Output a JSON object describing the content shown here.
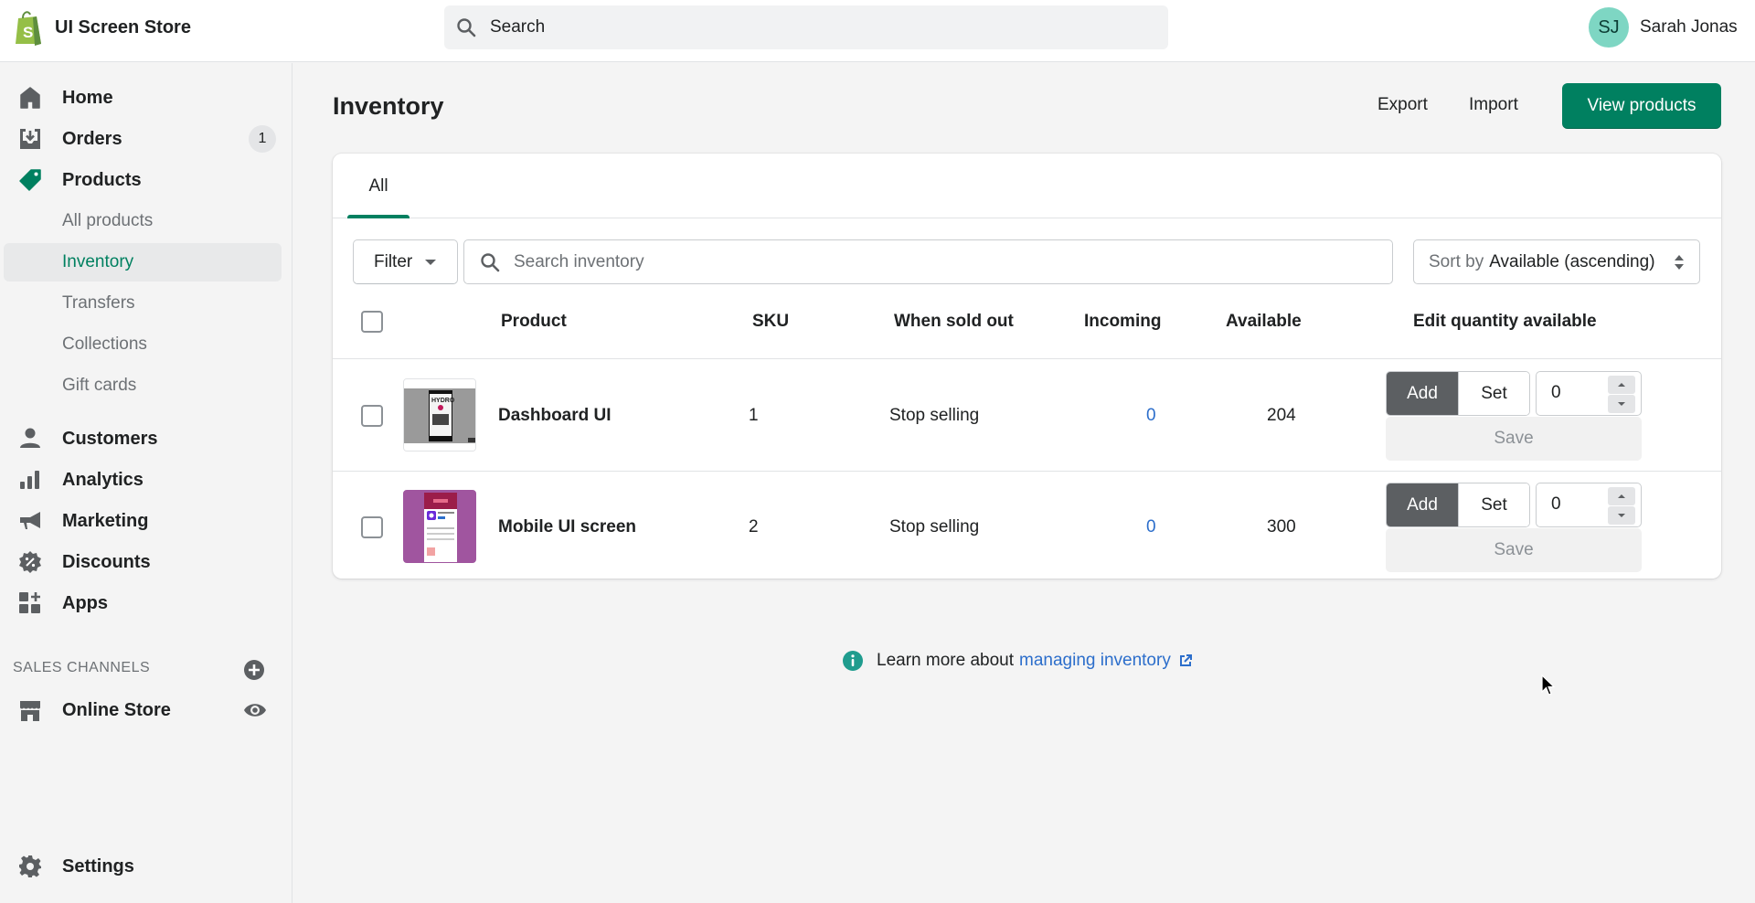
{
  "topbar": {
    "store_name": "UI Screen Store",
    "search_placeholder": "Search",
    "user": {
      "initials": "SJ",
      "name": "Sarah Jonas",
      "avatar_color": "#7ed6c3"
    }
  },
  "sidebar": {
    "items": [
      {
        "id": "home",
        "label": "Home",
        "icon": "home-icon"
      },
      {
        "id": "orders",
        "label": "Orders",
        "icon": "orders-icon",
        "badge": "1"
      },
      {
        "id": "products",
        "label": "Products",
        "icon": "tag-icon",
        "active": true
      },
      {
        "id": "customers",
        "label": "Customers",
        "icon": "person-icon"
      },
      {
        "id": "analytics",
        "label": "Analytics",
        "icon": "bar-chart-icon"
      },
      {
        "id": "marketing",
        "label": "Marketing",
        "icon": "megaphone-icon"
      },
      {
        "id": "discounts",
        "label": "Discounts",
        "icon": "discount-icon"
      },
      {
        "id": "apps",
        "label": "Apps",
        "icon": "apps-icon"
      }
    ],
    "product_subitems": [
      {
        "label": "All products"
      },
      {
        "label": "Inventory",
        "active": true
      },
      {
        "label": "Transfers"
      },
      {
        "label": "Collections"
      },
      {
        "label": "Gift cards"
      }
    ],
    "sales_channels_title": "SALES CHANNELS",
    "online_store_label": "Online Store",
    "settings_label": "Settings"
  },
  "page": {
    "title": "Inventory",
    "export_label": "Export",
    "import_label": "Import",
    "view_products_label": "View products",
    "tabs": [
      {
        "label": "All",
        "active": true
      }
    ],
    "filter_label": "Filter",
    "search_placeholder": "Search inventory",
    "sort_label": "Sort by",
    "sort_value": "Available (ascending)",
    "columns": [
      "Product",
      "SKU",
      "When sold out",
      "Incoming",
      "Available",
      "Edit quantity available"
    ],
    "rows": [
      {
        "product": "Dashboard UI",
        "sku": "1",
        "when_sold_out": "Stop selling",
        "incoming": "0",
        "available": "204",
        "mode_add": "Add",
        "mode_set": "Set",
        "quantity": "0",
        "save": "Save"
      },
      {
        "product": "Mobile UI screen",
        "sku": "2",
        "when_sold_out": "Stop selling",
        "incoming": "0",
        "available": "300",
        "mode_add": "Add",
        "mode_set": "Set",
        "quantity": "0",
        "save": "Save"
      }
    ],
    "help_text": "Learn more about",
    "help_link": "managing inventory"
  },
  "colors": {
    "accent_green": "#008060",
    "link_blue": "#2c6ecb",
    "segment_active": "#5c5f62"
  }
}
